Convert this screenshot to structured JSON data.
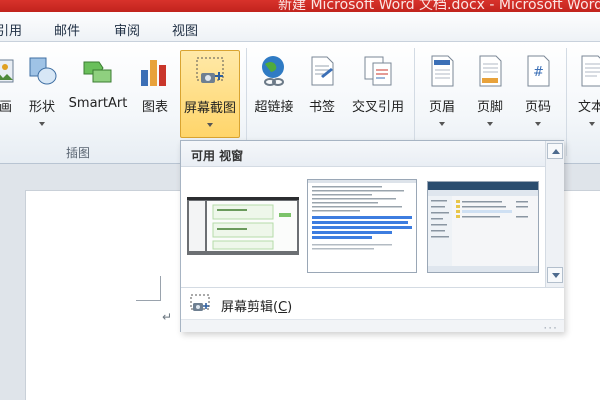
{
  "window": {
    "title": "新建 Microsoft Word 文档.docx - Microsoft Word"
  },
  "tabs": [
    {
      "label": "引用"
    },
    {
      "label": "邮件"
    },
    {
      "label": "审阅"
    },
    {
      "label": "视图"
    }
  ],
  "ribbon": {
    "illustrations": {
      "group_label": "插图",
      "buttons": [
        {
          "label": "画"
        },
        {
          "label": "形状"
        },
        {
          "label": "SmartArt"
        },
        {
          "label": "图表"
        },
        {
          "label": "屏幕截图"
        }
      ]
    },
    "links": {
      "buttons": [
        {
          "label": "超链接"
        },
        {
          "label": "书签"
        },
        {
          "label": "交叉引用"
        }
      ]
    },
    "header_footer": {
      "buttons": [
        {
          "label": "页眉"
        },
        {
          "label": "页脚"
        },
        {
          "label": "页码"
        }
      ]
    },
    "text": {
      "buttons": [
        {
          "label": "文本"
        }
      ]
    }
  },
  "screenshot_panel": {
    "header": "可用 视窗",
    "clip_label": "屏幕剪辑(",
    "clip_accel": "C",
    "clip_label_end": ")"
  },
  "document": {
    "paragraph_mark": "↵"
  },
  "colors": {
    "title_red": "#c1231d",
    "active_button": "#ffd56a",
    "ribbon_bg": "#f4f7fa"
  }
}
